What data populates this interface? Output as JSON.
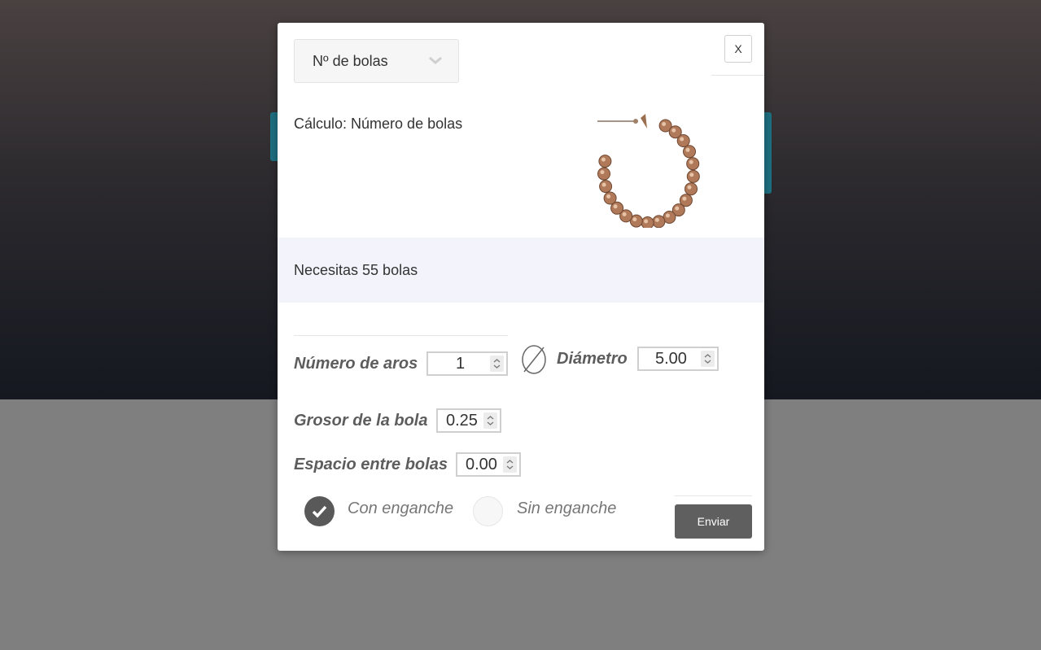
{
  "modal": {
    "select": {
      "value": "Nº de bolas"
    },
    "close_label": "X",
    "calc_title": "Cálculo: Número de bolas",
    "result_text": "Necesitas 55 bolas",
    "fields": {
      "aros": {
        "label": "Número de aros",
        "value": "1"
      },
      "diametro": {
        "label": "Diámetro",
        "value": "5.00"
      },
      "grosor": {
        "label": "Grosor de la bola",
        "value": "0.25"
      },
      "espacio": {
        "label": "Espacio entre bolas",
        "value": "0.00"
      }
    },
    "radios": {
      "con": {
        "label": "Con enganche",
        "checked": true
      },
      "sin": {
        "label": "Sin enganche",
        "checked": false
      }
    },
    "submit_label": "Enviar"
  },
  "colors": {
    "accent_teal": "#1e6f80",
    "button_dark": "#5f5f5f",
    "result_bg": "#f3f3fb",
    "bead": "#b07a5a"
  },
  "icons": [
    "chevron-down-icon",
    "check-icon",
    "diameter-icon",
    "spin-arrows-icon"
  ]
}
